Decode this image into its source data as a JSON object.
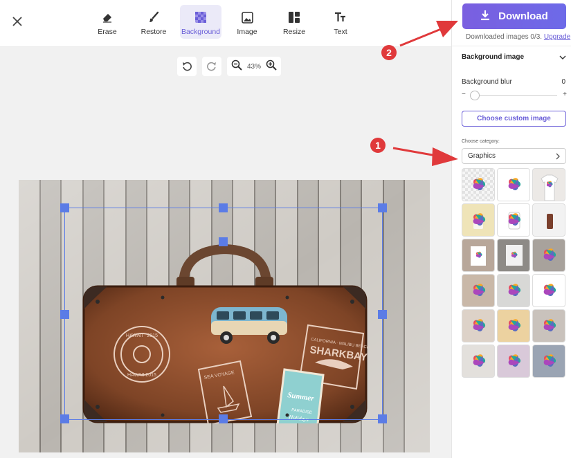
{
  "toolbar": {
    "tools": [
      {
        "label": "Erase",
        "icon": "eraser-icon"
      },
      {
        "label": "Restore",
        "icon": "brush-icon"
      },
      {
        "label": "Background",
        "icon": "checkerboard-icon",
        "active": true
      },
      {
        "label": "Image",
        "icon": "image-icon"
      },
      {
        "label": "Resize",
        "icon": "layout-icon"
      },
      {
        "label": "Text",
        "icon": "text-icon"
      }
    ]
  },
  "zoom": {
    "level": "43%"
  },
  "panel": {
    "download_label": "Download",
    "downloaded_text": "Downloaded images 0/3.",
    "upgrade_label": "Upgrade",
    "section_title": "Background image",
    "blur_label": "Background blur",
    "blur_value": "0",
    "blur_minus": "−",
    "blur_plus": "+",
    "custom_image_label": "Choose custom image",
    "category_label": "Choose category:",
    "category_value": "Graphics"
  },
  "annotations": {
    "badge1": "1",
    "badge2": "2"
  },
  "photo": {
    "stamp_left_top": "HAWAII · 2015",
    "stamp_left_bottom": "HAWAII 2015",
    "sea_voyage": "SEA VOYAGE",
    "shark_top": "CALIFORNIA · MALIBU BEACH",
    "shark_main": "SHARKBAY",
    "tag_summer": "Summer",
    "tag_paradise": "PARADISE",
    "tag_holidays": "Holidays"
  },
  "colors": {
    "accent": "#6a5ed8",
    "selection": "#5b7ce6",
    "annotation": "#e0393b"
  }
}
